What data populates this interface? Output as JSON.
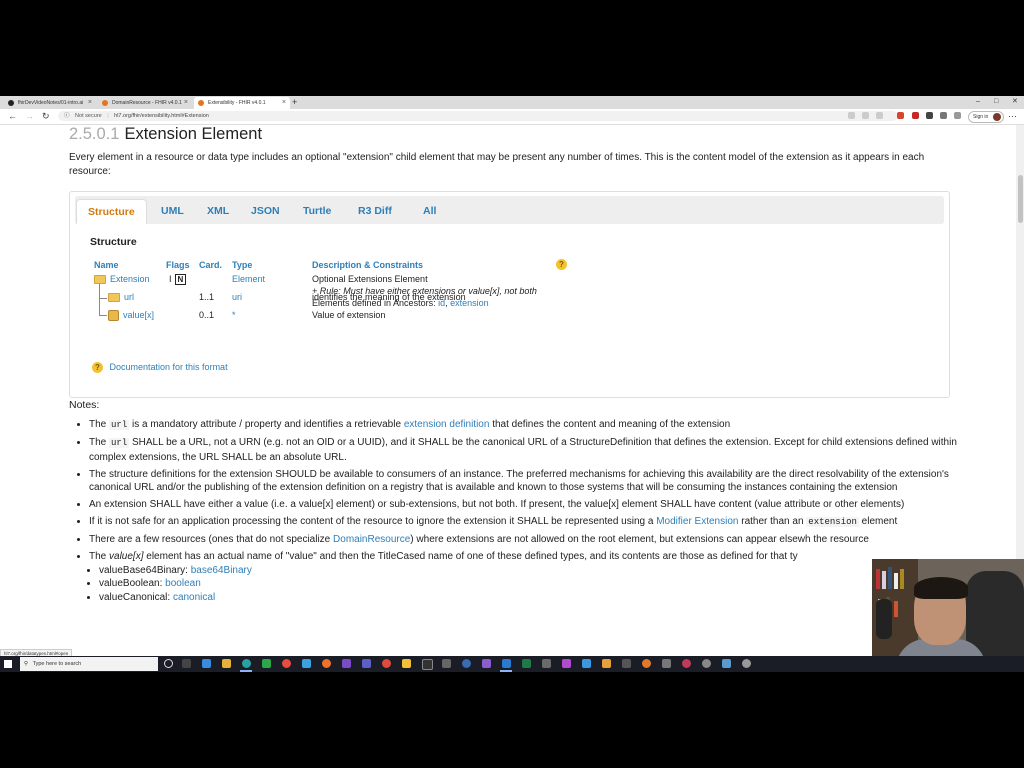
{
  "browser": {
    "tabs": [
      {
        "label": "fhirDevVideoNotes/01-intro.ai"
      },
      {
        "label": "DomainResource - FHIR v4.0.1"
      },
      {
        "label": "Extensibility - FHIR v4.0.1"
      }
    ],
    "not_secure": "Not secure",
    "url": "hl7.org/fhir/extensibility.html#Extension",
    "signin": "Sign in"
  },
  "page": {
    "section_number": "2.5.0.1",
    "section_title": "Extension Element",
    "intro": "Every element in a resource or data type includes an optional \"extension\" child element that may be present any number of times. This is the content model of the extension as it appears in each resource:",
    "tabs": [
      "Structure",
      "UML",
      "XML",
      "JSON",
      "Turtle",
      "R3 Diff",
      "All"
    ],
    "structure_heading": "Structure",
    "table": {
      "headers": [
        "Name",
        "Flags",
        "Card.",
        "Type",
        "Description & Constraints"
      ],
      "rows": {
        "extension": {
          "name": "Extension",
          "flag_i": "I",
          "flag_n": "N",
          "type": "Element",
          "desc1": "Optional Extensions Element",
          "desc2": "+ Rule: Must have either extensions or value[x], not both",
          "desc3_prefix": "Elements defined in Ancestors: ",
          "desc3_link1": "id",
          "desc3_sep": ", ",
          "desc3_link2": "extension"
        },
        "url": {
          "name": "url",
          "card": "1..1",
          "type": "uri",
          "desc": "identifies the meaning of the extension"
        },
        "value": {
          "name": "value[x]",
          "card": "0..1",
          "type": "*",
          "desc": "Value of extension"
        }
      }
    },
    "doc_link": "Documentation for this format",
    "notes_heading": "Notes:",
    "notes": {
      "n1": {
        "a": "The ",
        "code": "url",
        "b": " is a mandatory attribute / property and identifies a retrievable ",
        "link": "extension definition",
        "c": " that defines the content and meaning of the extension"
      },
      "n2": {
        "a": "The ",
        "code": "url",
        "b": " SHALL be a URL, not a URN (e.g. not an OID or a UUID), and it SHALL be the canonical URL of a StructureDefinition that defines the extension. Except for child extensions defined within complex extensions, the URL SHALL be an absolute URL."
      },
      "n3": "The structure definitions for the extension SHOULD be available to consumers of an instance. The preferred mechanisms for achieving this availability are the direct resolvability of the extension's canonical URL and/or the publishing of the extension definition on a registry that is available and known to those systems that will be consuming the instances containing the extension",
      "n4": "An extension SHALL have either a value (i.e. a value[x] element) or sub-extensions, but not both. If present, the value[x] element SHALL have content (value attribute or other elements)",
      "n5": {
        "a": "If it is not safe for an application processing the content of the resource to ignore the extension it SHALL be represented using a ",
        "link": "Modifier Extension",
        "b": " rather than an ",
        "code": "extension",
        "c": " element"
      },
      "n6": {
        "a": "There are a few resources (ones that do not specialize ",
        "link": "DomainResource",
        "b": ") where extensions are not allowed on the root element, but extensions can appear elsewh the resource"
      },
      "n7": {
        "a": "The ",
        "em": "value[x]",
        "b": " element has an actual name of \"value\" and then the TitleCased name of one of these defined types, and its contents are those as defined for that ty"
      },
      "sub": [
        {
          "label": "valueBase64Binary: ",
          "link": "base64Binary"
        },
        {
          "label": "valueBoolean: ",
          "link": "boolean"
        },
        {
          "label": "valueCanonical: ",
          "link": "canonical"
        }
      ]
    }
  },
  "status_url": "hl7.org/fhir/datatypes.html#open",
  "taskbar": {
    "search_placeholder": "Type here to search"
  },
  "colors": {
    "link": "#2e7fb8",
    "active_tab": "#d47a0a"
  }
}
